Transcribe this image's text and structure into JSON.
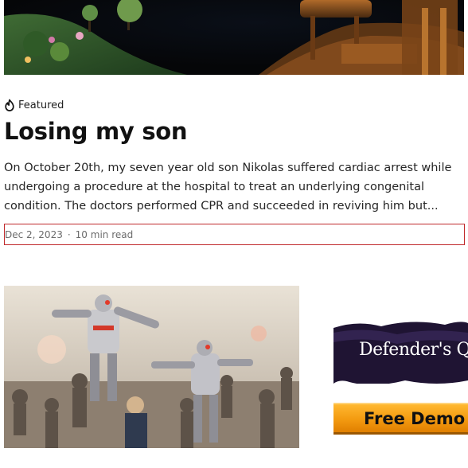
{
  "post": {
    "badge_icon": "flame-icon",
    "badge_label": "Featured",
    "title": "Losing my son",
    "excerpt": "On October 20th, my seven year old son Nikolas suffered cardiac arrest while undergoing a procedure at the hospital to treat an underlying congenital condition. The doctors performed CPR and succeeded in reviving him but...",
    "date": "Dec 2, 2023",
    "separator": "·",
    "read_time": "10 min read"
  },
  "ad": {
    "title": "Defender's Qu",
    "button_label": "Free Demo"
  },
  "colors": {
    "highlight_border": "#c0292b",
    "ad_button": "#f39a10"
  }
}
